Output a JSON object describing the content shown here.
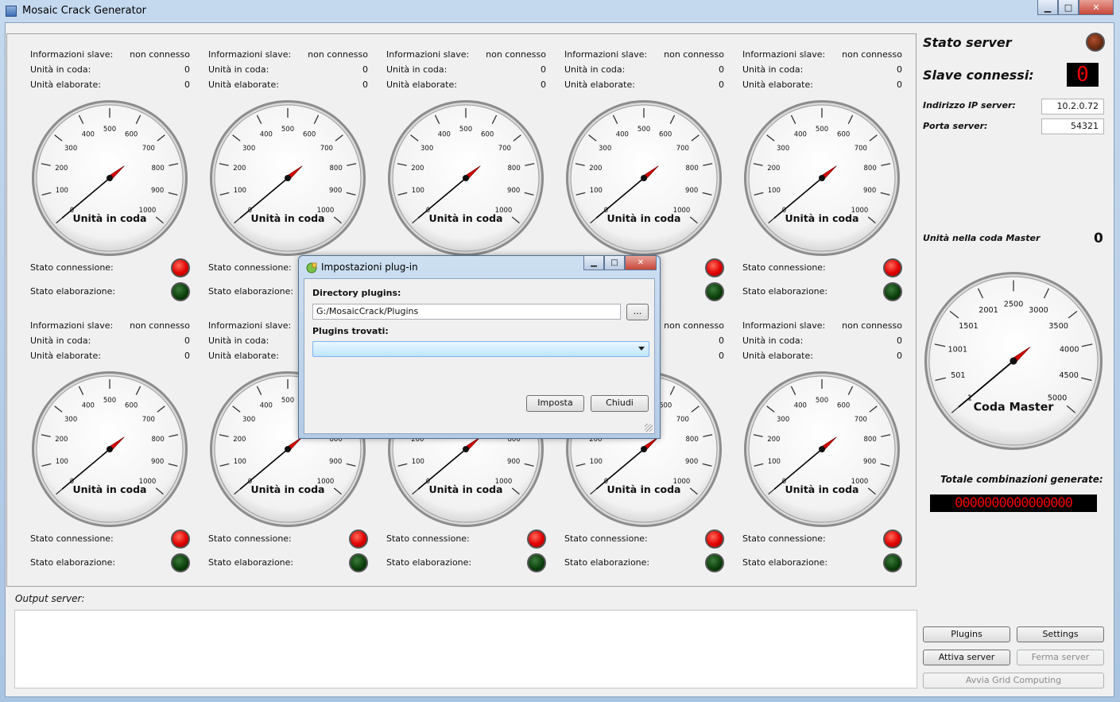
{
  "window": {
    "title": "Mosaic Crack Generator",
    "minimize": "▁",
    "maximize": "□",
    "close": "✕"
  },
  "slave": {
    "info_label": "Informazioni slave:",
    "info_value": "non connesso",
    "queue_label": "Unità in coda:",
    "queue_value": "0",
    "processed_label": "Unità elaborate:",
    "processed_value": "0",
    "gauge_title": "Unità in coda",
    "gauge_ticks": [
      "0",
      "100",
      "200",
      "300",
      "400",
      "500",
      "600",
      "700",
      "800",
      "900",
      "1000"
    ],
    "gauge_value": 0,
    "conn_label": "Stato connessione:",
    "proc_label": "Stato elaborazione:",
    "conn_color": "#e00000",
    "proc_color": "#0a3d0a",
    "count": 10
  },
  "server": {
    "status_title": "Stato server",
    "slaves_title": "Slave connessi:",
    "slaves_count": "0",
    "ip_label": "Indirizzo IP server:",
    "ip_value": "10.2.0.72",
    "port_label": "Porta server:",
    "port_value": "54321",
    "master_queue_label": "Unità nella coda Master",
    "master_queue_value": "0",
    "master_gauge_title": "Coda Master",
    "master_gauge_ticks": [
      "1",
      "501",
      "1001",
      "1501",
      "2001",
      "2500",
      "3000",
      "3500",
      "4000",
      "4500",
      "5000"
    ],
    "total_label": "Totale combinazioni generate:",
    "total_value": "0000000000000000"
  },
  "output": {
    "label": "Output server:"
  },
  "buttons": {
    "plugins": "Plugins",
    "settings": "Settings",
    "start_server": "Attiva server",
    "stop_server": "Ferma server",
    "grid": "Avvia Grid Computing"
  },
  "dialog": {
    "title": "Impostazioni plug-in",
    "dir_label": "Directory plugins:",
    "dir_value": "G:/MosaicCrack/Plugins",
    "browse": "...",
    "found_label": "Plugins trovati:",
    "found_value": "",
    "set": "Imposta",
    "close": "Chiudi"
  }
}
